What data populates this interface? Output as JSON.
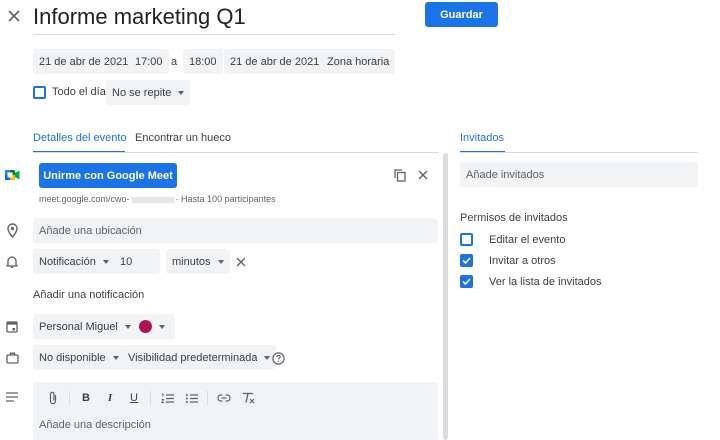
{
  "header": {
    "title": "Informe marketing Q1",
    "save_label": "Guardar"
  },
  "datetime": {
    "start_date": "21 de abr de 2021",
    "start_time": "17:00",
    "separator": "a",
    "end_time": "18:00",
    "end_date": "21 de abr de 2021",
    "timezone_label": "Zona horaria",
    "all_day_label": "Todo el día",
    "repeat_value": "No se repite"
  },
  "tabs": {
    "details": "Detalles del evento",
    "find_slot": "Encontrar un hueco",
    "guests": "Invitados"
  },
  "meet": {
    "join_label": "Unirme con Google Meet",
    "link_prefix": "meet.google.com/cwo-",
    "link_suffix": "· Hasta 100 participantes"
  },
  "location": {
    "placeholder": "Añade una ubicación"
  },
  "notification": {
    "type": "Notificación",
    "amount": "10",
    "unit": "minutos",
    "add_label": "Añadir una notificación"
  },
  "calendar": {
    "owner": "Personal Miguel",
    "color": "#ad1457"
  },
  "availability": {
    "status": "No disponible",
    "visibility": "Visibilidad predeterminada"
  },
  "description": {
    "placeholder": "Añade una descripción"
  },
  "guests": {
    "placeholder": "Añade invitados",
    "permissions_title": "Permisos de invitados",
    "permissions": [
      {
        "label": "Editar el evento",
        "checked": false
      },
      {
        "label": "Invitar a otros",
        "checked": true
      },
      {
        "label": "Ver la lista de invitados",
        "checked": true
      }
    ]
  },
  "colors": {
    "accent": "#1a73e8",
    "meet_green": "#00832d",
    "chip_bg": "#f1f3f4"
  },
  "icons": {
    "close": "close-icon",
    "meet": "google-meet-icon",
    "copy": "copy-icon",
    "location": "location-pin-icon",
    "bell": "bell-icon",
    "calendar": "calendar-icon",
    "briefcase": "briefcase-icon",
    "description": "description-lines-icon",
    "help": "help-circle-icon"
  }
}
